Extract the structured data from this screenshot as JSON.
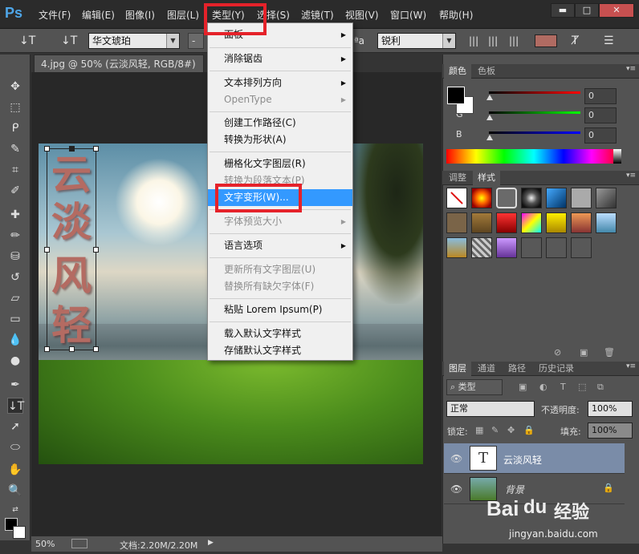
{
  "app": {
    "logo": "Ps"
  },
  "menubar": {
    "items": [
      {
        "label": "文件(F)"
      },
      {
        "label": "编辑(E)"
      },
      {
        "label": "图像(I)"
      },
      {
        "label": "图层(L)"
      },
      {
        "label": "类型(Y)"
      },
      {
        "label": "选择(S)"
      },
      {
        "label": "滤镜(T)"
      },
      {
        "label": "视图(V)"
      },
      {
        "label": "窗口(W)"
      },
      {
        "label": "帮助(H)"
      }
    ],
    "window_buttons": {
      "minimize": "▬",
      "maximize": "□",
      "close": "✕"
    }
  },
  "options": {
    "tool_icon": "↓T",
    "orientation_icon": "↓T",
    "font_family": "华文琥珀",
    "font_style": "-",
    "aa_icon": "ªa",
    "antialias": "锐利",
    "text_color": "#b06b62"
  },
  "document": {
    "tab_title": "4.jpg @ 50% (云淡风轻, RGB/8#) *",
    "close": "×",
    "vertical_text": [
      "云",
      "淡",
      "风",
      "轻"
    ],
    "zoom": "50%",
    "doc_size": "文档:2.20M/2.20M"
  },
  "type_menu": {
    "items": [
      {
        "label": "面板",
        "disabled": false,
        "submenu": true
      },
      {
        "label": "消除锯齿",
        "disabled": false,
        "submenu": true
      },
      {
        "label": "文本排列方向",
        "disabled": false,
        "submenu": true
      },
      {
        "label": "OpenType",
        "disabled": true,
        "submenu": true
      },
      {
        "label": "创建工作路径(C)",
        "disabled": false
      },
      {
        "label": "转换为形状(A)",
        "disabled": false
      },
      {
        "label": "栅格化文字图层(R)",
        "disabled": false
      },
      {
        "label": "转换为段落文本(P)",
        "disabled": true
      },
      {
        "label": "文字变形(W)...",
        "disabled": false,
        "highlighted": true
      },
      {
        "label": "字体预览大小",
        "disabled": true,
        "submenu": true
      },
      {
        "label": "语言选项",
        "disabled": false,
        "submenu": true
      },
      {
        "label": "更新所有文字图层(U)",
        "disabled": true
      },
      {
        "label": "替换所有缺欠字体(F)",
        "disabled": true
      },
      {
        "label": "粘贴 Lorem Ipsum(P)",
        "disabled": false
      },
      {
        "label": "载入默认文字样式",
        "disabled": false
      },
      {
        "label": "存储默认文字样式",
        "disabled": false
      }
    ]
  },
  "color_panel": {
    "tabs": [
      "颜色",
      "色板"
    ],
    "channels": [
      {
        "label": "R",
        "value": "0"
      },
      {
        "label": "G",
        "value": "0"
      },
      {
        "label": "B",
        "value": "0"
      }
    ],
    "foreground": "#000000",
    "background": "#ffffff"
  },
  "styles_panel": {
    "tabs": [
      "调整",
      "样式"
    ]
  },
  "layers_panel": {
    "tabs": [
      "图层",
      "通道",
      "路径",
      "历史记录"
    ],
    "filter": "类型",
    "blend_mode": "正常",
    "opacity_label": "不透明度:",
    "opacity": "100%",
    "lock_label": "锁定:",
    "fill_label": "填充:",
    "fill": "100%",
    "layers": [
      {
        "name": "云淡风轻",
        "kind": "text",
        "thumb": "T",
        "selected": true
      },
      {
        "name": "背景",
        "kind": "image",
        "locked": true
      }
    ]
  },
  "watermark": {
    "brand": "Bai",
    "paw": "du",
    "product": "经验",
    "url": "jingyan.baidu.com"
  }
}
